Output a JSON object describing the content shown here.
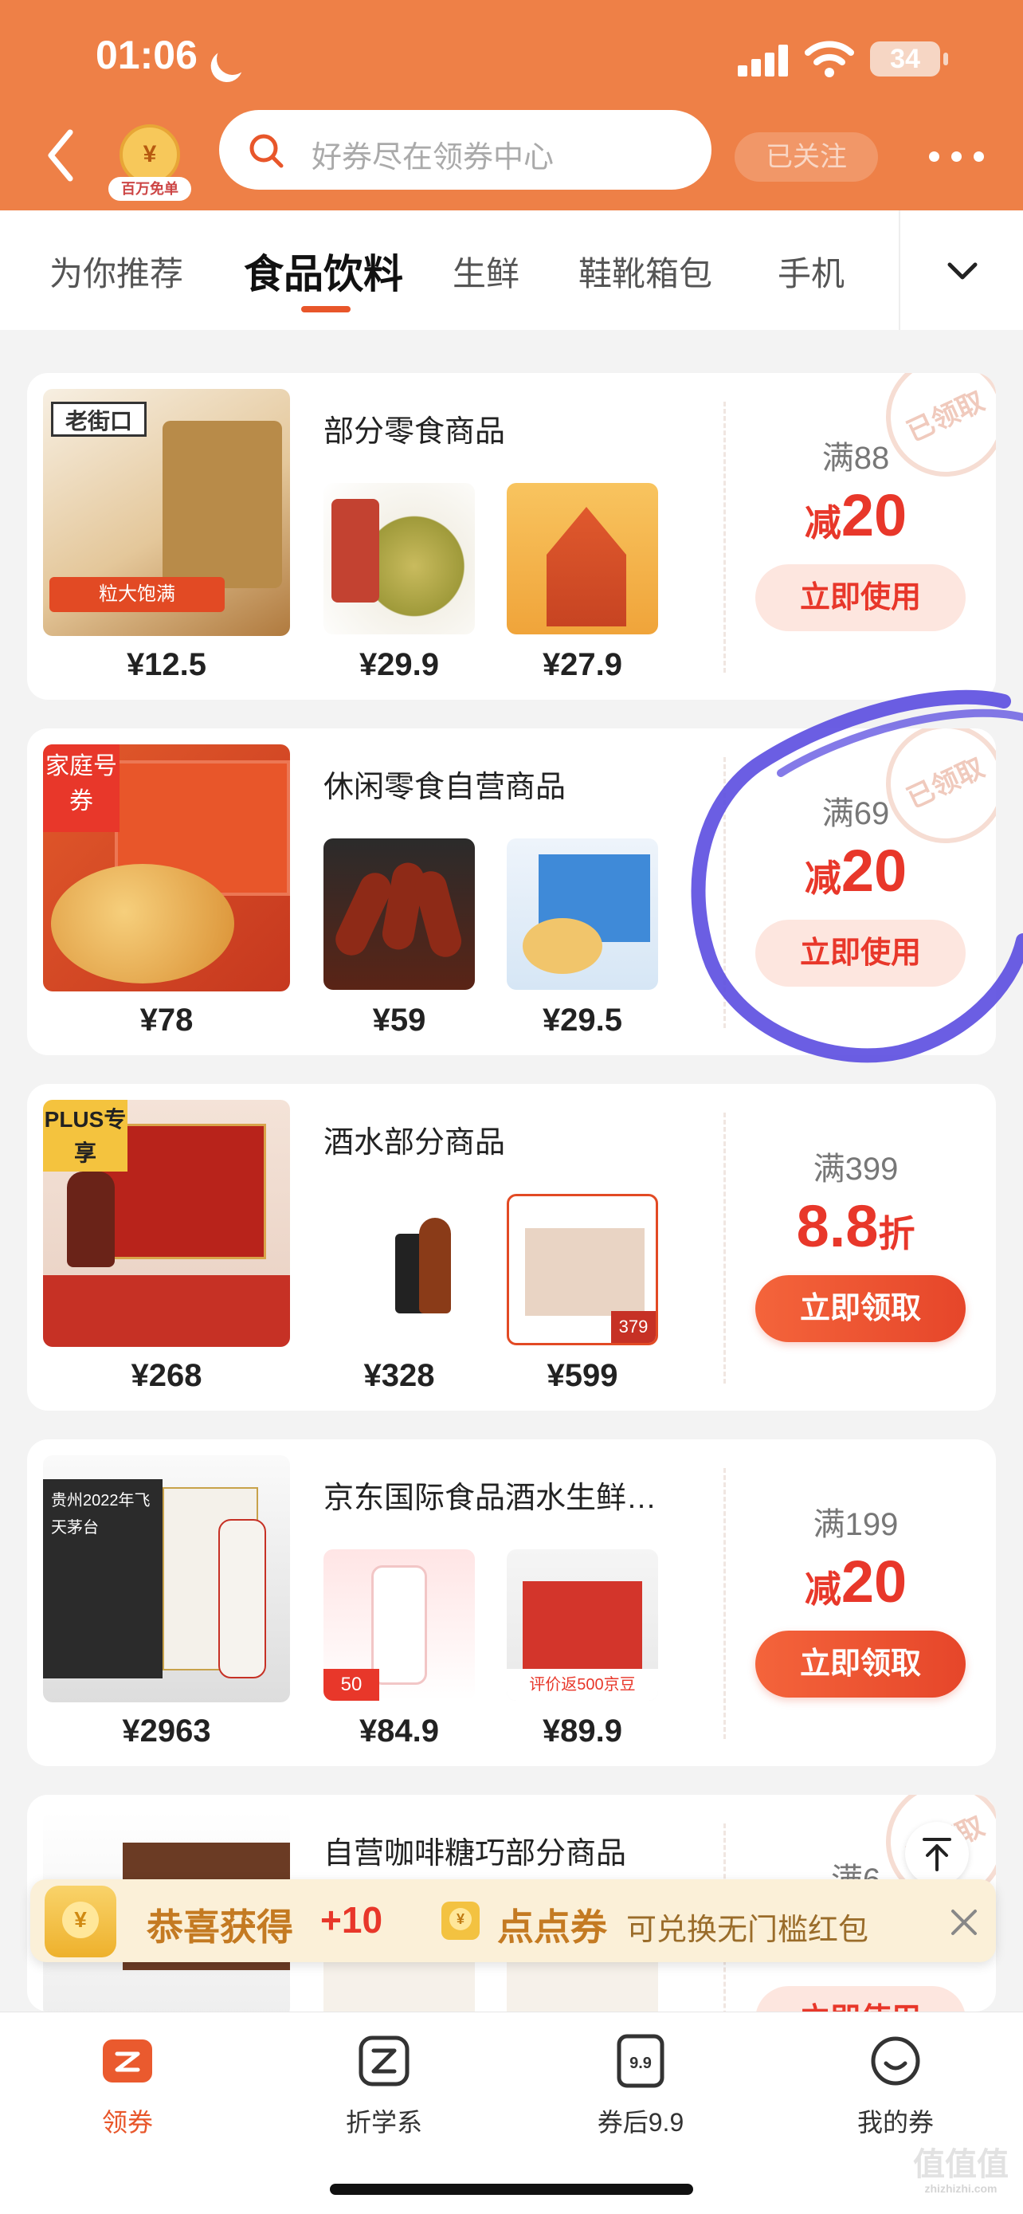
{
  "status_bar": {
    "time": "01:06",
    "battery": "34"
  },
  "header": {
    "shop_logo_text": "百万免单",
    "search_placeholder": "好券尽在领券中心",
    "follow_label": "已关注"
  },
  "tabs": [
    {
      "label": "为你推荐",
      "active": false
    },
    {
      "label": "食品饮料",
      "active": true
    },
    {
      "label": "生鲜",
      "active": false
    },
    {
      "label": "鞋靴箱包",
      "active": false
    },
    {
      "label": "手机",
      "active": false
    }
  ],
  "coupons": [
    {
      "title": "部分零食商品",
      "main_price": "¥12.5",
      "sub_prices": [
        "¥29.9",
        "¥27.9"
      ],
      "threshold": "满88",
      "discount_prefix": "减",
      "discount_value": "20",
      "cta": "立即使用",
      "cta_type": "used",
      "stamp": "已领取",
      "image_text": {
        "brand": "老街口",
        "promo": "粒大饱满"
      }
    },
    {
      "title": "休闲零食自营商品",
      "main_price": "¥78",
      "sub_prices": [
        "¥59",
        "¥29.5"
      ],
      "threshold": "满69",
      "discount_prefix": "减",
      "discount_value": "20",
      "cta": "立即使用",
      "cta_type": "used",
      "stamp": "已领取",
      "image_text": {
        "badge": "家庭号券"
      }
    },
    {
      "title": "酒水部分商品",
      "main_price": "¥268",
      "sub_prices": [
        "¥328",
        "¥599"
      ],
      "threshold": "满399",
      "discount_value": "8.8",
      "discount_suffix": "折",
      "cta": "立即领取",
      "cta_type": "claim",
      "image_text": {
        "badge": "PLUS专享",
        "tag": "379"
      }
    },
    {
      "title": "京东国际食品酒水生鲜…",
      "main_price": "¥2963",
      "sub_prices": [
        "¥84.9",
        "¥89.9"
      ],
      "threshold": "满199",
      "discount_prefix": "减",
      "discount_value": "20",
      "cta": "立即领取",
      "cta_type": "claim",
      "image_text": {
        "panel": "贵州2022年飞天茅台",
        "tag": "50",
        "paste": "评价返500京豆"
      }
    },
    {
      "title": "自营咖啡糖巧部分商品",
      "threshold": "满6",
      "cta": "立即使用",
      "cta_type": "used",
      "stamp": "已领取"
    }
  ],
  "toast": {
    "prefix": "恭喜获得",
    "plus": "+10",
    "coin_name": "点点券",
    "note": "可兑换无门槛红包"
  },
  "bottom_nav": [
    {
      "label": "领券",
      "icon": "coupon-icon",
      "active": true
    },
    {
      "label": "折学系",
      "icon": "z-icon",
      "active": false
    },
    {
      "label": "券后9.9",
      "icon": "price-tag-icon",
      "badge": "9.9",
      "active": false
    },
    {
      "label": "我的券",
      "icon": "smile-icon",
      "active": false
    }
  ],
  "watermark": {
    "main": "值值值",
    "small": "zhizhizhi.com"
  },
  "colors": {
    "brand_orange": "#ee8047",
    "accent_red": "#e8372a",
    "highlight_blue": "#5b4de0"
  }
}
